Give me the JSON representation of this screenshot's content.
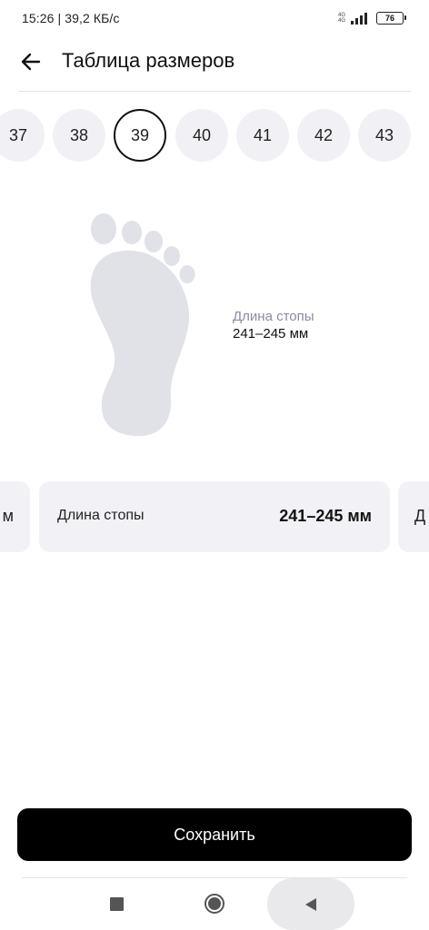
{
  "status_bar": {
    "time_speed": "15:26 | 39,2 КБ/с",
    "network_top": "4G",
    "network_bottom": "4G",
    "battery": "76"
  },
  "header": {
    "title": "Таблица размеров"
  },
  "sizes": {
    "items": [
      "37",
      "38",
      "39",
      "40",
      "41",
      "42",
      "43"
    ],
    "selected": "39"
  },
  "foot_info": {
    "label": "Длина стопы",
    "value": "241–245 мм"
  },
  "cards": {
    "left_partial": "м",
    "main_label": "Длина стопы",
    "main_value": "241–245 мм",
    "right_partial": "Д"
  },
  "actions": {
    "save_label": "Сохранить"
  },
  "nav": {
    "recent_icon": "square-icon",
    "home_icon": "circle-icon",
    "back_icon": "triangle-back-icon"
  },
  "colors": {
    "accent": "#000000",
    "chip_bg": "#f1f1f5",
    "foot_fill": "#e1e1e8",
    "muted_label": "#8c8aa3"
  }
}
